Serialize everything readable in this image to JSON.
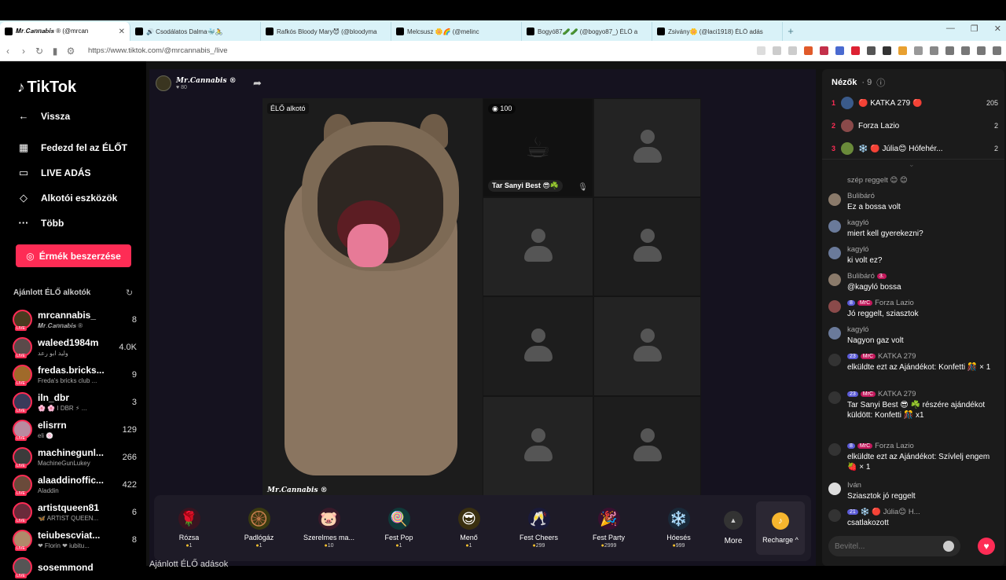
{
  "browser": {
    "tabs": [
      {
        "title": "𝑴𝒓.𝑪𝒂𝒏𝒏𝒂𝒃𝒊𝒔 ® (@mrcan",
        "active": true
      },
      {
        "title": "🔊 Csodálatos Dalma🐳🚴",
        "active": false
      },
      {
        "title": "Rafkós Bloody Mary😈 (@bloodyma",
        "active": false
      },
      {
        "title": "Melcsusz 🌼🌈 (@melinc",
        "active": false
      },
      {
        "title": "Bogyó87🥒🥒 (@bogyo87_) ÉLŐ a",
        "active": false
      },
      {
        "title": "Zsivány🌼 (@laci1918) ÉLŐ adás",
        "active": false
      }
    ],
    "new_tab": "+",
    "window_controls": [
      "—",
      "❐",
      "✕"
    ],
    "url": "https://www.tiktok.com/@mrcannabis_/live"
  },
  "sidebar": {
    "logo": "TikTok",
    "back": "Vissza",
    "nav": [
      {
        "label": "Fedezd fel az ÉLŐT",
        "icon": "explore-live-icon"
      },
      {
        "label": "LIVE ADÁS",
        "icon": "camera-icon"
      },
      {
        "label": "Alkotói eszközök",
        "icon": "creator-tools-icon"
      },
      {
        "label": "Több",
        "icon": "more-dots-icon"
      }
    ],
    "coins_button": "Érmék beszerzése",
    "recommended_title": "Ajánlott ÉLŐ alkotók",
    "creators": [
      {
        "name": "mrcannabis_",
        "sub": "𝑴𝒓.𝑪𝒂𝒏𝒏𝒂𝒃𝒊𝒔 ®",
        "count": "8",
        "color": "#4a3b1f"
      },
      {
        "name": "waleed1984m",
        "sub": "وليد ابو رعد",
        "count": "4.0K",
        "color": "#5a4a4a"
      },
      {
        "name": "fredas.bricks...",
        "sub": "Freda's bricks club ...",
        "count": "9",
        "color": "#a06a2a"
      },
      {
        "name": "iln_dbr",
        "sub": "🌸 🌸 I DBR ⚡ ...",
        "count": "3",
        "color": "#3a3a5a"
      },
      {
        "name": "elisrrn",
        "sub": "eli 🍥",
        "count": "129",
        "color": "#b98aa0"
      },
      {
        "name": "machinegunl...",
        "sub": "MachineGunLukey",
        "count": "266",
        "color": "#3b3b3b"
      },
      {
        "name": "alaaddinoffic...",
        "sub": "Aladdin",
        "count": "422",
        "color": "#6a4a3a"
      },
      {
        "name": "artistqueen81",
        "sub": "🦋 ARTIST QUEEN...",
        "count": "6",
        "color": "#6a2a3a"
      },
      {
        "name": "teiubescviat...",
        "sub": "❤ Florin ❤ iubitu...",
        "count": "8",
        "color": "#b08a6a"
      },
      {
        "name": "sosemmond",
        "sub": "",
        "count": "",
        "color": "#555"
      }
    ]
  },
  "stage": {
    "host_name": "𝑴𝒓.𝑪𝒂𝒏𝒏𝒂𝒃𝒊𝒔 ®",
    "host_likes": "80",
    "main_label": "ÉLŐ alkotó",
    "watermark": "𝑴𝒓.𝑪𝒂𝒏𝒏𝒂𝒃𝒊𝒔 ®",
    "guest_badge": "100",
    "guest_name": "Tar Sanyi Best 😎☘️",
    "gifts": [
      {
        "name": "Rózsa",
        "price": "1",
        "icon": "🌹",
        "bg": "#3a1420"
      },
      {
        "name": "Padlógáz",
        "price": "1",
        "icon": "🛞",
        "bg": "#3a3a10"
      },
      {
        "name": "Szerelmes ma...",
        "price": "10",
        "icon": "🐷",
        "bg": "#3a1a2a"
      },
      {
        "name": "Fest Pop",
        "price": "1",
        "icon": "🍭",
        "bg": "#103a3a"
      },
      {
        "name": "Menő",
        "price": "1",
        "icon": "😎",
        "bg": "#3a3010"
      },
      {
        "name": "Fest Cheers",
        "price": "299",
        "icon": "🥂",
        "bg": "#1a1a3a"
      },
      {
        "name": "Fest Party",
        "price": "2999",
        "icon": "🎉",
        "bg": "#3a1030"
      },
      {
        "name": "Hóesés",
        "price": "999",
        "icon": "❄️",
        "bg": "#1a2a3a"
      }
    ],
    "more_label": "More",
    "recharge_label": "Recharge ^",
    "below_title": "Ajánlott ÉLŐ adások"
  },
  "chat": {
    "viewers_title": "Nézők",
    "viewers_count": "· 9",
    "top_viewers": [
      {
        "rank": "1",
        "name": "🔴 KATKA 279 🔴",
        "score": "205",
        "color": "#3a5a8a"
      },
      {
        "rank": "2",
        "name": "Forza Lazio",
        "score": "2",
        "color": "#8a4a4a"
      },
      {
        "rank": "3",
        "name": "❄️ 🔴 Júlia😊 Hófehér...",
        "score": "2",
        "color": "#6a8a3a"
      }
    ],
    "messages": [
      {
        "user": "szép reggelt 😊 😊",
        "text": "",
        "color": "#777"
      },
      {
        "user": "Bulibáró",
        "text": "Ez a bossa volt",
        "color": "#8a7a6a"
      },
      {
        "user": "kagyló",
        "text": "miert kell gyerekezni?",
        "color": "#6a7a9a"
      },
      {
        "user": "kagyló",
        "text": "ki volt ez?",
        "color": "#6a7a9a"
      },
      {
        "user": "Bulibáró",
        "badge": "3.",
        "text": "@kagyló bossa",
        "color": "#8a7a6a"
      },
      {
        "user": "Forza Lazio",
        "badge": "8",
        "text": "Jó reggelt, sziasztok",
        "color": "#8a4a4a"
      },
      {
        "user": "kagyló",
        "text": "Nagyon gaz volt",
        "color": "#6a7a9a"
      },
      {
        "user": "KATKA 279",
        "badge": "23",
        "text": "elküldte ezt az Ajándékot: Konfetti 🎊 × 1",
        "color": "#333"
      },
      {
        "user": "KATKA 279",
        "badge": "23",
        "text": "Tar Sanyi Best 😎 ☘️ részére ajándékot küldött: Konfetti 🎊 x1",
        "color": "#333"
      },
      {
        "user": "Forza Lazio",
        "badge": "8",
        "text": "elküldte ezt az Ajándékot: Szívlelj engem 🍓 × 1",
        "color": "#333"
      },
      {
        "user": "Iván",
        "text": "Sziasztok jó reggelt",
        "color": "#ddd"
      },
      {
        "user": "❄️ 🔴 Júlia😊 H...",
        "badge": "21",
        "text": "csatlakozott",
        "color": "#333"
      }
    ],
    "input_placeholder": "Bevitel...",
    "accent": "#fe2c55"
  }
}
